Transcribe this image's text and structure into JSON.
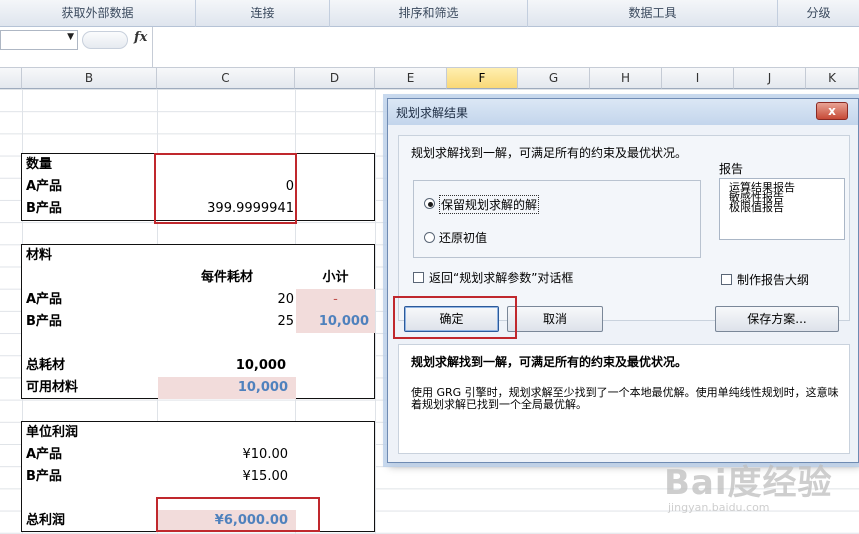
{
  "ribbon": {
    "groups": [
      "获取外部数据",
      "连接",
      "排序和筛选",
      "数据工具",
      "分级"
    ]
  },
  "formula_bar": {
    "name_box_value": "",
    "fx_label": "fx",
    "formula_value": ""
  },
  "columns": [
    "B",
    "C",
    "D",
    "E",
    "F",
    "G",
    "H",
    "I",
    "J",
    "K"
  ],
  "selected_column": "F",
  "sheet": {
    "quantity": {
      "header": "数量",
      "rows": [
        {
          "label": "A产品",
          "value": "0"
        },
        {
          "label": "B产品",
          "value": "399.9999941"
        }
      ]
    },
    "materials": {
      "header": "材料",
      "col_headers": [
        "每件耗材",
        "小计"
      ],
      "rows": [
        {
          "label": "A产品",
          "per_unit": "20",
          "subtotal": "-"
        },
        {
          "label": "B产品",
          "per_unit": "25",
          "subtotal": "10,000"
        }
      ],
      "total_label": "总耗材",
      "total_value": "10,000",
      "available_label": "可用材料",
      "available_value": "10,000"
    },
    "profit": {
      "header": "单位利润",
      "rows": [
        {
          "label": "A产品",
          "value": "¥10.00"
        },
        {
          "label": "B产品",
          "value": "¥15.00"
        }
      ],
      "total_label": "总利润",
      "total_value": "¥6,000.00"
    }
  },
  "dialog": {
    "title": "规划求解结果",
    "close_label": "x",
    "message": "规划求解找到一解，可满足所有的约束及最优状况。",
    "option_keep": "保留规划求解的解",
    "option_restore": "还原初值",
    "selected_option": "keep",
    "reports_label": "报告",
    "reports": [
      "运算结果报告",
      "敏感性报告",
      "极限值报告"
    ],
    "return_checkbox": "返回“规划求解参数”对话框",
    "outline_checkbox": "制作报告大纲",
    "ok_button": "确定",
    "cancel_button": "取消",
    "save_button": "保存方案...",
    "desc_title": "规划求解找到一解，可满足所有的约束及最优状况。",
    "desc_text": "使用 GRG 引擎时，规划求解至少找到了一个本地最优解。使用单纯线性规划时，这意味着规划求解已找到一个全局最优解。"
  },
  "watermark": {
    "logo_text": "Bai度经验",
    "url": "jingyan.baidu.com"
  },
  "colors": {
    "highlight_red": "#c0282d",
    "pink_fill": "#f2dcdb",
    "blue_text": "#4f81bd"
  }
}
